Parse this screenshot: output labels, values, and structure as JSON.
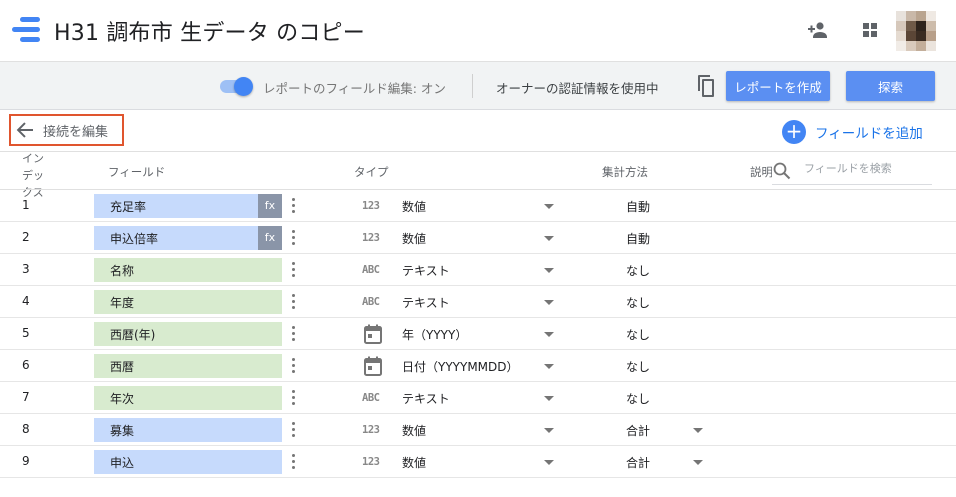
{
  "header": {
    "title": "H31 調布市 生データ のコピー",
    "icons": [
      "looker-studio-logo-icon",
      "add-person-icon",
      "apps-grid-icon",
      "account-avatar"
    ]
  },
  "toolbar": {
    "field_edit_label": "レポートのフィールド編集: オン",
    "field_edit_on": true,
    "credentials_label": "オーナーの認証情報を使用中",
    "create_report_label": "レポートを作成",
    "explore_label": "探索"
  },
  "edit_connection_label": "接続を編集",
  "add_field_label": "フィールドを追加",
  "columns": {
    "index": "インデックス",
    "field": "フィールド",
    "type": "タイプ",
    "aggregation": "集計方法",
    "description": "説明"
  },
  "search": {
    "placeholder": "フィールドを検索"
  },
  "rows": [
    {
      "index": "1",
      "name": "充足率",
      "kind": "metric",
      "formula": true,
      "type_icon": "123",
      "type": "数値",
      "aggregation": "自動",
      "agg_dropdown": false
    },
    {
      "index": "2",
      "name": "申込倍率",
      "kind": "metric",
      "formula": true,
      "type_icon": "123",
      "type": "数値",
      "aggregation": "自動",
      "agg_dropdown": false
    },
    {
      "index": "3",
      "name": "名称",
      "kind": "dimension",
      "formula": false,
      "type_icon": "ABC",
      "type": "テキスト",
      "aggregation": "なし",
      "agg_dropdown": false
    },
    {
      "index": "4",
      "name": "年度",
      "kind": "dimension",
      "formula": false,
      "type_icon": "ABC",
      "type": "テキスト",
      "aggregation": "なし",
      "agg_dropdown": false
    },
    {
      "index": "5",
      "name": "西暦(年)",
      "kind": "dimension",
      "formula": false,
      "type_icon": "calendar",
      "type": "年（YYYY）",
      "aggregation": "なし",
      "agg_dropdown": false
    },
    {
      "index": "6",
      "name": "西暦",
      "kind": "dimension",
      "formula": false,
      "type_icon": "calendar",
      "type": "日付（YYYYMMDD）",
      "aggregation": "なし",
      "agg_dropdown": false
    },
    {
      "index": "7",
      "name": "年次",
      "kind": "dimension",
      "formula": false,
      "type_icon": "ABC",
      "type": "テキスト",
      "aggregation": "なし",
      "agg_dropdown": false
    },
    {
      "index": "8",
      "name": "募集",
      "kind": "metric",
      "formula": false,
      "type_icon": "123",
      "type": "数値",
      "aggregation": "合計",
      "agg_dropdown": true
    },
    {
      "index": "9",
      "name": "申込",
      "kind": "metric",
      "formula": false,
      "type_icon": "123",
      "type": "数値",
      "aggregation": "合計",
      "agg_dropdown": true
    }
  ],
  "formula_badge": "fx",
  "colors": {
    "accent": "#4285f4",
    "metric_chip": "#c6dafc",
    "dimension_chip": "#d8ebcf",
    "highlight_border": "#e0552e"
  }
}
